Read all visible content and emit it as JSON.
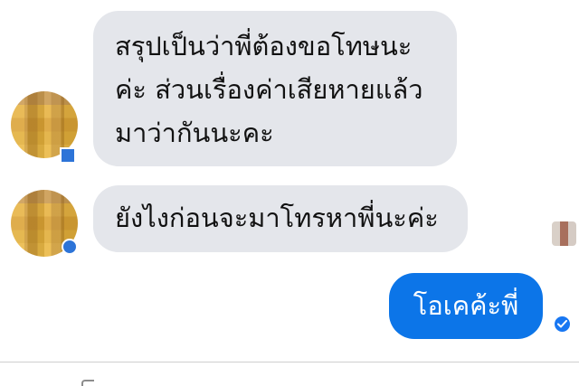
{
  "conversation": {
    "incoming": [
      {
        "lines": [
          "สรุปเป็นว่าพี่ต้องขอโทษนะ",
          "ค่ะ ส่วนเรื่องค่าเสียหายแล้ว",
          "มาว่ากันนะคะ"
        ]
      },
      {
        "lines": [
          "ยังไงก่อนจะมาโทรหาพี่นะค่ะ"
        ]
      }
    ],
    "outgoing": {
      "text": "โอเคค้ะพี่"
    }
  },
  "icons": {
    "avatar": "sender-avatar",
    "seen": "seen-avatar",
    "sent": "sent-check-icon",
    "composer": "composer-icon"
  },
  "colors": {
    "incoming_bubble": "#e4e6eb",
    "outgoing_bubble": "#0c75e8",
    "badge": "#2d74d8"
  }
}
